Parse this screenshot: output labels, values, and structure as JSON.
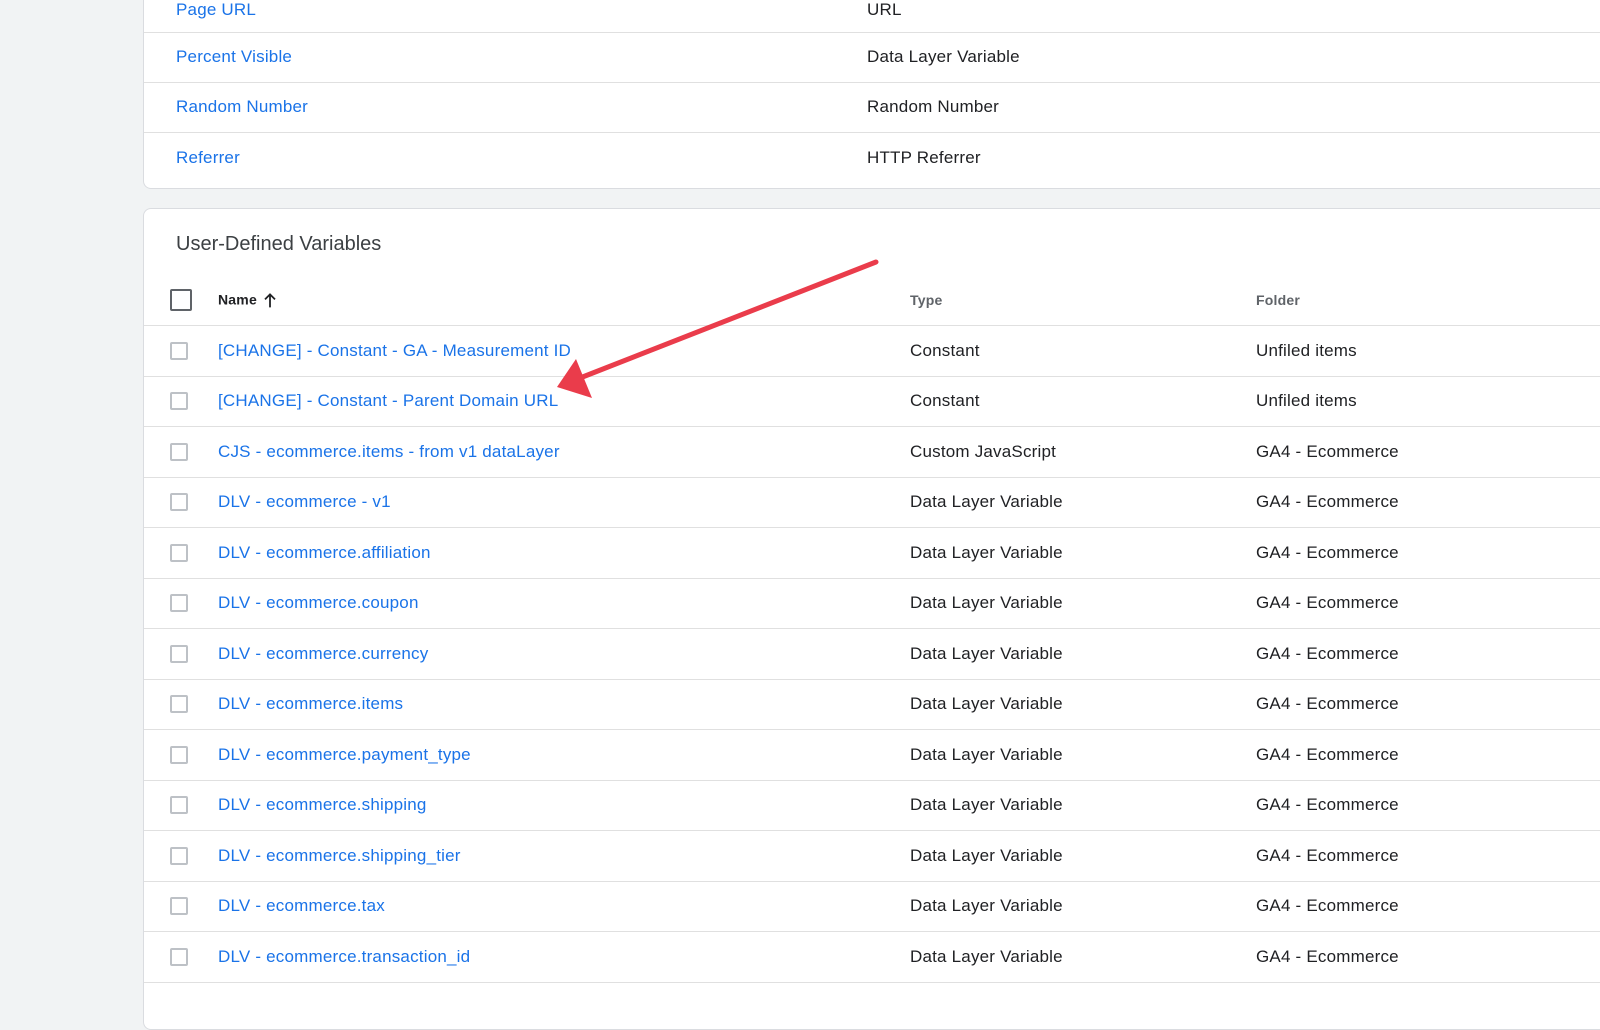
{
  "builtin": {
    "rows": [
      {
        "name": "Page URL",
        "type": "URL"
      },
      {
        "name": "Percent Visible",
        "type": "Data Layer Variable"
      },
      {
        "name": "Random Number",
        "type": "Random Number"
      },
      {
        "name": "Referrer",
        "type": "HTTP Referrer"
      }
    ]
  },
  "udv": {
    "title": "User-Defined Variables",
    "columns": {
      "name": "Name",
      "type": "Type",
      "folder": "Folder"
    },
    "sort_icon": "arrow-up-icon",
    "rows": [
      {
        "name": "[CHANGE] - Constant - GA - Measurement ID",
        "type": "Constant",
        "folder": "Unfiled items"
      },
      {
        "name": "[CHANGE] - Constant - Parent Domain URL",
        "type": "Constant",
        "folder": "Unfiled items"
      },
      {
        "name": "CJS - ecommerce.items - from v1 dataLayer",
        "type": "Custom JavaScript",
        "folder": "GA4 - Ecommerce"
      },
      {
        "name": "DLV - ecommerce - v1",
        "type": "Data Layer Variable",
        "folder": "GA4 - Ecommerce"
      },
      {
        "name": "DLV - ecommerce.affiliation",
        "type": "Data Layer Variable",
        "folder": "GA4 - Ecommerce"
      },
      {
        "name": "DLV - ecommerce.coupon",
        "type": "Data Layer Variable",
        "folder": "GA4 - Ecommerce"
      },
      {
        "name": "DLV - ecommerce.currency",
        "type": "Data Layer Variable",
        "folder": "GA4 - Ecommerce"
      },
      {
        "name": "DLV - ecommerce.items",
        "type": "Data Layer Variable",
        "folder": "GA4 - Ecommerce"
      },
      {
        "name": "DLV - ecommerce.payment_type",
        "type": "Data Layer Variable",
        "folder": "GA4 - Ecommerce"
      },
      {
        "name": "DLV - ecommerce.shipping",
        "type": "Data Layer Variable",
        "folder": "GA4 - Ecommerce"
      },
      {
        "name": "DLV - ecommerce.shipping_tier",
        "type": "Data Layer Variable",
        "folder": "GA4 - Ecommerce"
      },
      {
        "name": "DLV - ecommerce.tax",
        "type": "Data Layer Variable",
        "folder": "GA4 - Ecommerce"
      },
      {
        "name": "DLV - ecommerce.transaction_id",
        "type": "Data Layer Variable",
        "folder": "GA4 - Ecommerce"
      }
    ]
  },
  "annotation": {
    "type": "arrow",
    "color": "#ea3c4b",
    "points_to": "[CHANGE] - Constant - Parent Domain URL"
  },
  "colors": {
    "link": "#1a73e8",
    "background": "#f1f3f4",
    "card": "#ffffff",
    "divider": "#e0e0e0"
  }
}
